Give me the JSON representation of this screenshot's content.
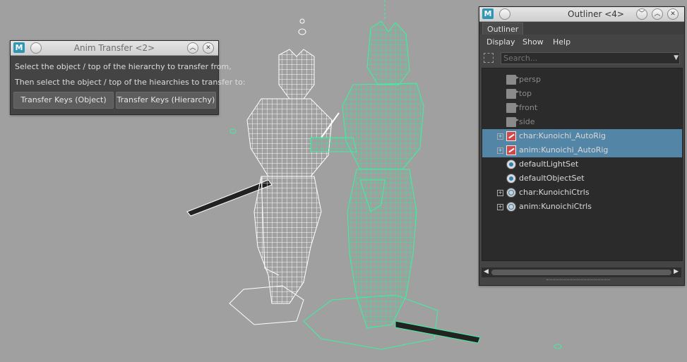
{
  "colors": {
    "viewport_bg": "#a0a0a0",
    "selection": "#5285a6",
    "wire_green": "#3ef0a0",
    "wire_white": "#ffffff"
  },
  "anim_transfer": {
    "title": "Anim Transfer <2>",
    "logo": "M",
    "instruction_1": "Select the object / top of the hierarchy to transfer from,",
    "instruction_2": "Then select the object / top of the hiearchies to transfer to:",
    "button_object": "Transfer Keys (Object)",
    "button_hierarchy": "Transfer Keys (Hierarchy)"
  },
  "outliner": {
    "title": "Outliner <4>",
    "logo": "M",
    "tab": "Outliner",
    "menu": [
      "Display",
      "Show",
      "Help"
    ],
    "search_placeholder": "Search...",
    "items": [
      {
        "label": "persp",
        "icon": "camera-icon",
        "expandable": false,
        "selected": false,
        "dim": true
      },
      {
        "label": "top",
        "icon": "camera-icon",
        "expandable": false,
        "selected": false,
        "dim": true
      },
      {
        "label": "front",
        "icon": "camera-icon",
        "expandable": false,
        "selected": false,
        "dim": true
      },
      {
        "label": "side",
        "icon": "camera-icon",
        "expandable": false,
        "selected": false,
        "dim": true
      },
      {
        "label": "char:Kunoichi_AutoRig",
        "icon": "joint-rig-icon",
        "expandable": true,
        "selected": true,
        "dim": false
      },
      {
        "label": "anim:Kunoichi_AutoRig",
        "icon": "joint-rig-icon",
        "expandable": true,
        "selected": true,
        "dim": false
      },
      {
        "label": "defaultLightSet",
        "icon": "set-icon",
        "expandable": false,
        "selected": false,
        "dim": false
      },
      {
        "label": "defaultObjectSet",
        "icon": "set-icon",
        "expandable": false,
        "selected": false,
        "dim": false
      },
      {
        "label": "char:KunoichiCtrls",
        "icon": "controls-icon",
        "expandable": true,
        "selected": false,
        "dim": false
      },
      {
        "label": "anim:KunoichiCtrls",
        "icon": "controls-icon",
        "expandable": true,
        "selected": false,
        "dim": false
      }
    ]
  }
}
